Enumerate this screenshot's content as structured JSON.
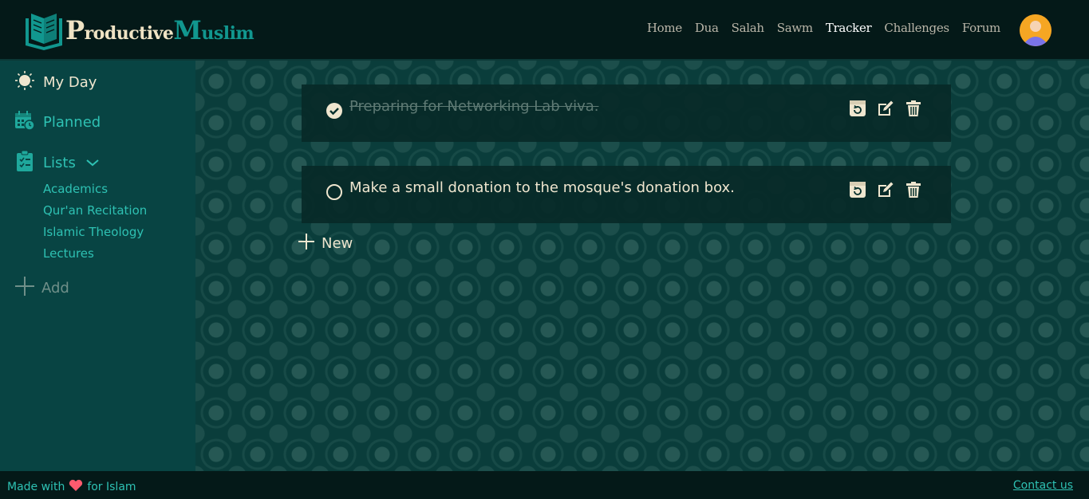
{
  "brand": {
    "first_letter": "P",
    "first_rest": "roductive",
    "second_letter": "M",
    "second_rest": "uslim"
  },
  "nav": {
    "items": [
      {
        "label": "Home"
      },
      {
        "label": "Dua"
      },
      {
        "label": "Salah"
      },
      {
        "label": "Sawm"
      },
      {
        "label": "Tracker"
      },
      {
        "label": "Challenges"
      },
      {
        "label": "Forum"
      }
    ],
    "active": "Tracker"
  },
  "sidebar": {
    "my_day": "My Day",
    "planned": "Planned",
    "lists": "Lists",
    "list_items": [
      "Academics",
      "Qur'an Recitation",
      "Islamic Theology",
      "Lectures"
    ],
    "add": "Add"
  },
  "tasks": [
    {
      "text": "Preparing for Networking Lab viva.",
      "done": true
    },
    {
      "text": "Make a small donation to the mosque's donation box.",
      "done": false
    }
  ],
  "new_label": "New",
  "footer": {
    "made_with": "Made with",
    "for_islam": "for Islam",
    "contact": "Contact us"
  },
  "colors": {
    "accent": "#2ec1b3",
    "cream": "#efe6cf",
    "header_bg": "#041918",
    "sidebar_bg": "#084443",
    "heart": "#ff5a6e",
    "avatar": "#f5a623"
  },
  "icons": {
    "logo": "book-icon",
    "sidebar": [
      "sun-icon",
      "calendar-clock-icon",
      "clipboard-list-icon",
      "chevron-down-icon",
      "plus-icon"
    ],
    "task_actions": [
      "repeat-icon",
      "edit-icon",
      "trash-icon"
    ]
  }
}
